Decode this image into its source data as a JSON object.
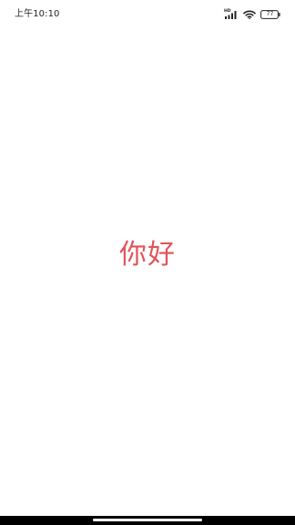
{
  "status_bar": {
    "time": "上午10:10",
    "network_label": "HD",
    "battery_level": "77"
  },
  "main": {
    "greeting": "你好",
    "greeting_color": "#e0545a"
  },
  "nav_bar": {
    "home_indicator_icon": "home-indicator"
  }
}
